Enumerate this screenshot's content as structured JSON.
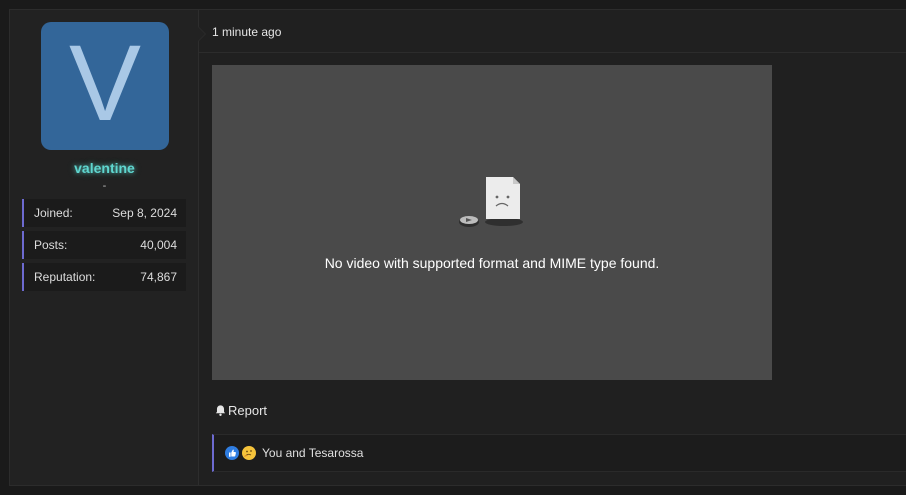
{
  "user": {
    "avatar_letter": "V",
    "avatar_color": "#336699",
    "username": "valentine",
    "username_color": "#5fd6cf",
    "title": "-",
    "stats": [
      {
        "label": "Joined:",
        "value": "Sep 8, 2024"
      },
      {
        "label": "Posts:",
        "value": "40,004"
      },
      {
        "label": "Reputation:",
        "value": "74,867"
      }
    ]
  },
  "message": {
    "timestamp": "1 minute ago",
    "video": {
      "error_text": "No video with supported format and MIME type found.",
      "icon": "sad-file-icon"
    },
    "actions": {
      "report_label": "Report",
      "report_icon": "bell-icon"
    },
    "reactions": {
      "icons": [
        "like-icon",
        "thinking-face-icon"
      ],
      "text": "You and Tesarossa"
    }
  },
  "colors": {
    "accent": "#6d6ad0",
    "background": "#202020"
  }
}
